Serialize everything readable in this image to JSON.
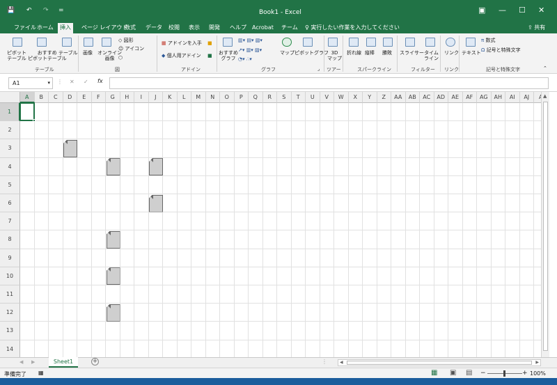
{
  "window": {
    "title": "Book1  -  Excel",
    "quick_access": {
      "save": "💾",
      "undo": "↶",
      "redo": "↷",
      "customize": "="
    },
    "controls": {
      "ribbon_options": "▣",
      "minimize": "—",
      "maximize": "☐",
      "close": "✕"
    }
  },
  "tabs": [
    {
      "label": "ファイル"
    },
    {
      "label": "ホーム"
    },
    {
      "label": "挿入"
    },
    {
      "label": "ページ レイアウト"
    },
    {
      "label": "数式"
    },
    {
      "label": "データ"
    },
    {
      "label": "校閲"
    },
    {
      "label": "表示"
    },
    {
      "label": "開発"
    },
    {
      "label": "ヘルプ"
    },
    {
      "label": "Acrobat"
    },
    {
      "label": "チーム"
    }
  ],
  "tell_me": "実行したい作業を入力してください",
  "share": "共有",
  "ribbon": {
    "pivot": "ピボット\nテーブル",
    "rec_pivot": "おすすめ\nピボットテーブル",
    "table": "テーブル",
    "group_table": "テーブル",
    "image": "画像",
    "online_image": "オンライン\n画像",
    "shapes": "図形",
    "icons": "アイコン",
    "group_figure": "図",
    "get_addins": "アドインを入手",
    "my_addins": "個人用アドイン",
    "group_addins": "アドイン",
    "rec_chart": "おすすめ\nグラフ",
    "map": "マップ",
    "pivot_chart": "ピボットグラフ",
    "group_chart": "グラフ",
    "map3d": "3D\nマップ",
    "group_tour": "ツアー",
    "line": "折れ線",
    "column": "縦棒",
    "winloss": "勝敗",
    "group_spark": "スパークライン",
    "slicer": "スライサー",
    "timeline": "タイム\nライン",
    "group_filter": "フィルター",
    "link": "リンク",
    "group_link": "リンク",
    "text": "テキスト",
    "equation": "数式",
    "symbol": "記号と特殊文字",
    "group_symbol": "記号と特殊文字"
  },
  "formula_bar": {
    "name_box": "A1",
    "cancel": "✕",
    "enter": "✓",
    "fx": "fx",
    "formula": ""
  },
  "columns": [
    "A",
    "B",
    "C",
    "D",
    "E",
    "F",
    "G",
    "H",
    "I",
    "J",
    "K",
    "L",
    "M",
    "N",
    "O",
    "P",
    "Q",
    "R",
    "S",
    "T",
    "U",
    "V",
    "W",
    "X",
    "Y",
    "Z",
    "AA",
    "AB",
    "AC",
    "AD",
    "AE",
    "AF",
    "AG",
    "AH",
    "AI",
    "AJ",
    "A"
  ],
  "rows": [
    "1",
    "2",
    "3",
    "4",
    "5",
    "6",
    "7",
    "8",
    "9",
    "10",
    "11",
    "12",
    "13",
    "14"
  ],
  "active_cell": "A1",
  "comment_cells": [
    "D3",
    "G4",
    "J4",
    "J6",
    "G8",
    "G10",
    "G12"
  ],
  "sheet_tabs": [
    {
      "label": "Sheet1"
    }
  ],
  "add_sheet": "+",
  "status": {
    "ready": "準備完了",
    "zoom": "100%",
    "zoom_minus": "−",
    "zoom_plus": "+"
  },
  "colors": {
    "accent": "#217346",
    "active_cell_border": "#217346"
  }
}
